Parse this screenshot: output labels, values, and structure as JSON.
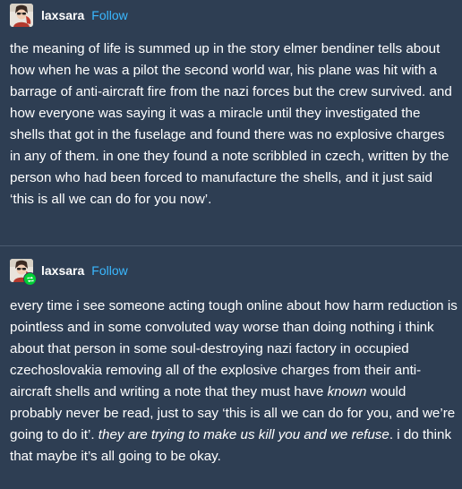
{
  "posts": [
    {
      "username": "laxsara",
      "follow_label": "Follow",
      "avatar_icon": "user-avatar",
      "reblog": false,
      "body": [
        {
          "text": "the meaning of life is summed up in the story elmer bendiner tells about how when he was a pilot the second world war, his plane was hit with a barrage of anti-aircraft fire from the nazi forces but the crew survived. and how everyone was saying it was a miracle until they investigated the shells that got in the fuselage and found there was no explosive charges in any of them. in one they found a note scribbled in czech, written by the person who had been forced to manufacture the shells, and it just said ‘this is all we can do for you now’.",
          "italic": false
        }
      ]
    },
    {
      "username": "laxsara",
      "follow_label": "Follow",
      "avatar_icon": "user-avatar",
      "reblog": true,
      "reblog_icon": "reblog-icon",
      "body": [
        {
          "text": "every time i see someone acting tough online about how harm reduction is pointless and in some convoluted way worse than doing nothing i think about that person in some soul-destroying nazi factory in occupied czechoslovakia removing all of the explosive charges from their anti-aircraft shells and writing a note that they must have ",
          "italic": false
        },
        {
          "text": "known",
          "italic": true
        },
        {
          "text": " would probably never be read, just to say ‘this is all we can do for you, and we’re going to do it’. ",
          "italic": false
        },
        {
          "text": "they are trying to make us kill you and we refuse",
          "italic": true
        },
        {
          "text": ". i do think that maybe it’s all going to be okay.",
          "italic": false
        }
      ]
    }
  ],
  "colors": {
    "background": "#2e3e53",
    "text": "#ffffff",
    "follow": "#3ab8ff",
    "divider": "#4a5a6f",
    "reblog_badge": "#00cf35"
  }
}
